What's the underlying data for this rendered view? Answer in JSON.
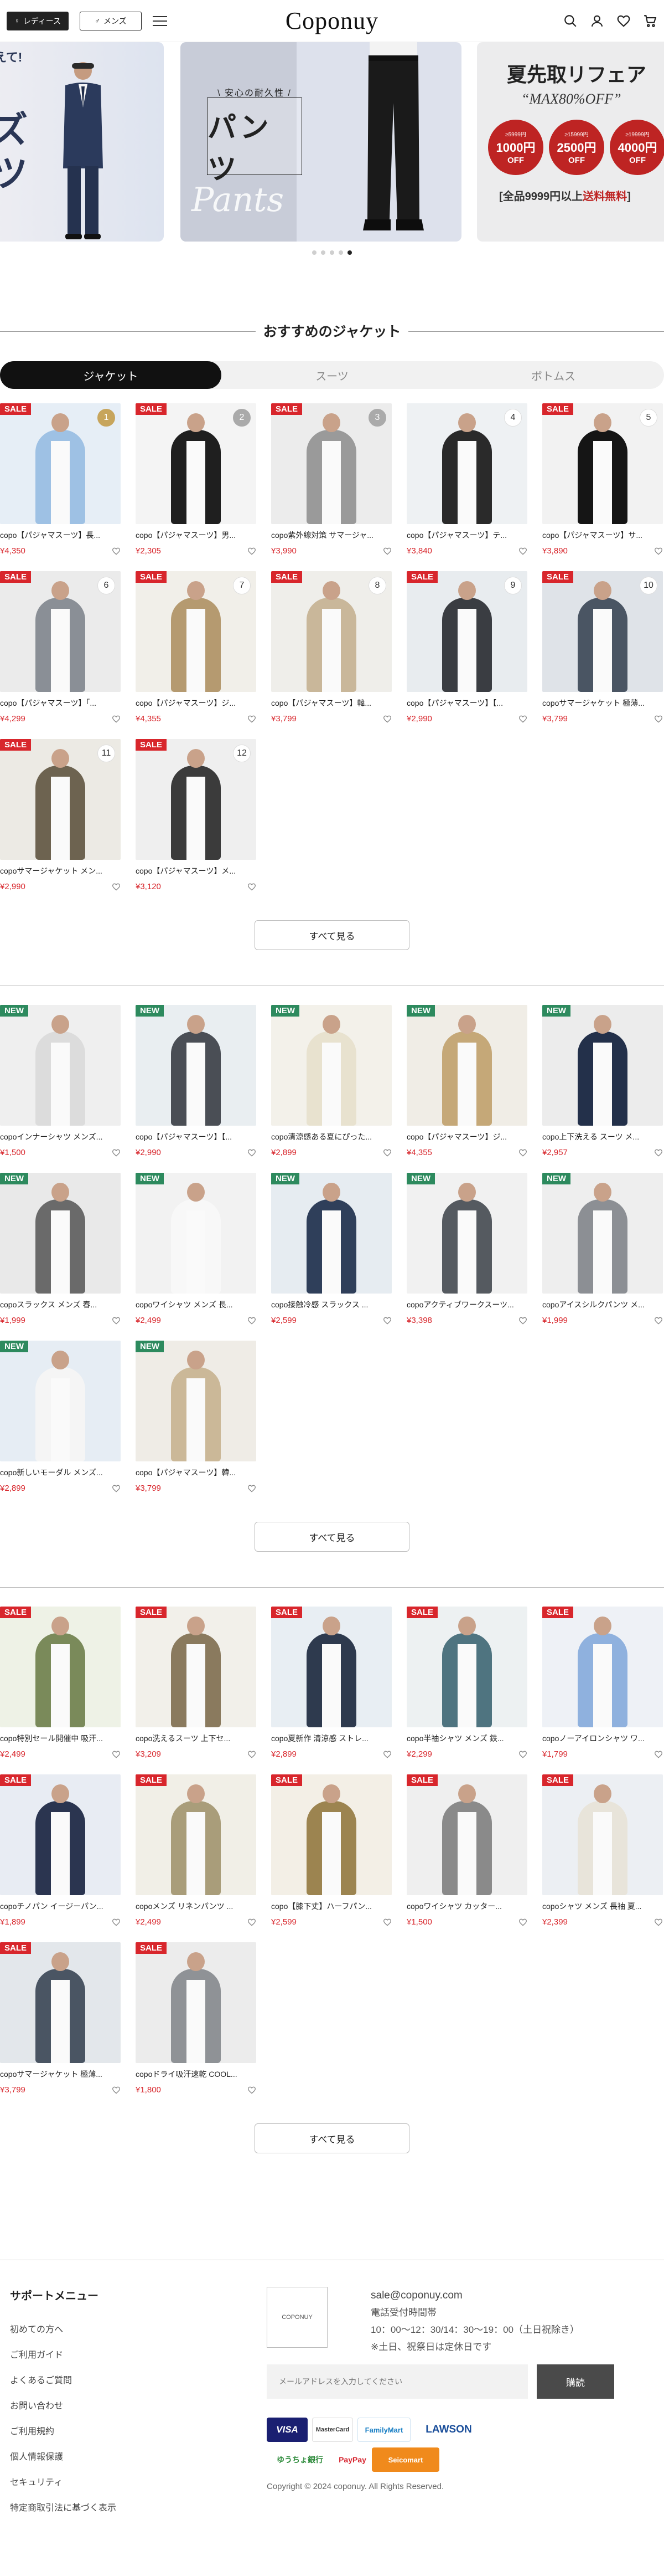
{
  "header": {
    "ladies_label": "レディース",
    "mens_label": "メンズ",
    "logo": "Coponuy"
  },
  "banner": {
    "slide1": {
      "corner": "えて!",
      "big": "ズ\nツ"
    },
    "slide2": {
      "small": "\\ 安心の耐久性 /",
      "large": "パンツ",
      "script": "Pants"
    },
    "slide3": {
      "title": "夏先取リフェア",
      "subtitle": "“MAX80%OFF”",
      "offers": [
        {
          "cond": "≥5999円",
          "amount": "1000円",
          "off": "OFF"
        },
        {
          "cond": "≥15999円",
          "amount": "2500円",
          "off": "OFF"
        },
        {
          "cond": "≥19999円",
          "amount": "4000円",
          "off": "OFF"
        }
      ],
      "note_prefix": "[全品9999円以上",
      "note_red": "送料無料",
      "note_suffix": "]"
    },
    "dot_count": 5,
    "active_dot": 4
  },
  "section1": {
    "title": "おすすめのジャケット",
    "tabs": [
      "ジャケット",
      "スーツ",
      "ボトムス"
    ],
    "active_tab": 0,
    "more_label": "すべて見る",
    "products": [
      {
        "name": "copo【パジャマスーツ】長...",
        "price": "¥4,350",
        "badge": "SALE",
        "rank": "1",
        "bg": "#e6eef6",
        "body": "#9ec1e4"
      },
      {
        "name": "copo【パジャマスーツ】男...",
        "price": "¥2,305",
        "badge": "SALE",
        "rank": "2",
        "bg": "#f4f4f4",
        "body": "#1f1f1f"
      },
      {
        "name": "copo紫外線対策 サマージャ...",
        "price": "¥3,990",
        "badge": "SALE",
        "rank": "3",
        "bg": "#ececec",
        "body": "#9a9a9a"
      },
      {
        "name": "copo【パジャマスーツ】テ...",
        "price": "¥3,840",
        "badge": "",
        "rank": "4",
        "bg": "#eef1f3",
        "body": "#2a2a2a"
      },
      {
        "name": "copo【パジャマスーツ】サ...",
        "price": "¥3,890",
        "badge": "SALE",
        "rank": "5",
        "bg": "#f2f2f2",
        "body": "#151515"
      },
      {
        "name": "copo【パジャマスーツ】「...",
        "price": "¥4,299",
        "badge": "SALE",
        "rank": "6",
        "bg": "#ebebeb",
        "body": "#8a8f96"
      },
      {
        "name": "copo【パジャマスーツ】ジ...",
        "price": "¥4,355",
        "badge": "SALE",
        "rank": "7",
        "bg": "#f1efe9",
        "body": "#b59a70"
      },
      {
        "name": "copo【パジャマスーツ】韓...",
        "price": "¥3,799",
        "badge": "SALE",
        "rank": "8",
        "bg": "#efeeea",
        "body": "#c9b79a"
      },
      {
        "name": "copo【パジャマスーツ】【...",
        "price": "¥2,990",
        "badge": "SALE",
        "rank": "9",
        "bg": "#e8ecef",
        "body": "#3a3d42"
      },
      {
        "name": "copoサマージャケット 極薄...",
        "price": "¥3,799",
        "badge": "SALE",
        "rank": "10",
        "bg": "#dfe3e8",
        "body": "#4a5563"
      },
      {
        "name": "copoサマージャケット メン...",
        "price": "¥2,990",
        "badge": "SALE",
        "rank": "11",
        "bg": "#eceae4",
        "body": "#6d6350"
      },
      {
        "name": "copo【パジャマスーツ】メ...",
        "price": "¥3,120",
        "badge": "SALE",
        "rank": "12",
        "bg": "#efefef",
        "body": "#3b3b3b"
      }
    ]
  },
  "section2": {
    "more_label": "すべて見る",
    "products": [
      {
        "name": "copoインナーシャツ メンズ...",
        "price": "¥1,500",
        "badge": "NEW",
        "bg": "#efefef",
        "body": "#dcdcdc"
      },
      {
        "name": "copo【パジャマスーツ】【...",
        "price": "¥2,990",
        "badge": "NEW",
        "bg": "#e9eef1",
        "body": "#4a4e55"
      },
      {
        "name": "copo清涼感ある夏にぴった...",
        "price": "¥2,899",
        "badge": "NEW",
        "bg": "#f3f1ea",
        "body": "#e8e2cf"
      },
      {
        "name": "copo【パジャマスーツ】ジ...",
        "price": "¥4,355",
        "badge": "NEW",
        "bg": "#f0ede6",
        "body": "#c5a878"
      },
      {
        "name": "copo上下洗える スーツ メ...",
        "price": "¥2,957",
        "badge": "NEW",
        "bg": "#ececec",
        "body": "#23304a"
      },
      {
        "name": "copoスラックス メンズ 春...",
        "price": "¥1,999",
        "badge": "NEW",
        "bg": "#e9e9e9",
        "body": "#6a6a6a"
      },
      {
        "name": "copoワイシャツ メンズ 長...",
        "price": "¥2,499",
        "badge": "NEW",
        "bg": "#f2f2f2",
        "body": "#f8f8f8"
      },
      {
        "name": "copo接触冷感 スラックス ...",
        "price": "¥2,599",
        "badge": "NEW",
        "bg": "#e6ecf1",
        "body": "#2f3f5a"
      },
      {
        "name": "copoアクティブワークスーツ...",
        "price": "¥3,398",
        "badge": "NEW",
        "bg": "#f1f1f1",
        "body": "#555a60"
      },
      {
        "name": "copoアイスシルクパンツ メ...",
        "price": "¥1,999",
        "badge": "NEW",
        "bg": "#eeeeee",
        "body": "#8c8f94"
      },
      {
        "name": "copo新しいモーダル メンズ...",
        "price": "¥2,899",
        "badge": "NEW",
        "bg": "#e6edf4",
        "body": "#f5f5f5"
      },
      {
        "name": "copo【パジャマスーツ】韓...",
        "price": "¥3,799",
        "badge": "NEW",
        "bg": "#efece6",
        "body": "#cbb898"
      }
    ]
  },
  "section3": {
    "more_label": "すべて見る",
    "products": [
      {
        "name": "copo特別セール開催中 吸汗...",
        "price": "¥2,499",
        "badge": "SALE",
        "bg": "#eef2e6",
        "body": "#7a8a5a"
      },
      {
        "name": "copo洗えるスーツ 上下セ...",
        "price": "¥3,209",
        "badge": "SALE",
        "bg": "#f2f0ea",
        "body": "#8a7a5e"
      },
      {
        "name": "copo夏新作 清涼感 ストレ...",
        "price": "¥2,899",
        "badge": "SALE",
        "bg": "#e8eef3",
        "body": "#2e3a4e"
      },
      {
        "name": "copo半袖シャツ メンズ 鉄...",
        "price": "¥2,299",
        "badge": "SALE",
        "bg": "#edf1f2",
        "body": "#4f7480"
      },
      {
        "name": "copoノーアイロンシャツ ワ...",
        "price": "¥1,799",
        "badge": "SALE",
        "bg": "#eef1f6",
        "body": "#8fb1de"
      },
      {
        "name": "copoチノパン イージーパン...",
        "price": "¥1,899",
        "badge": "SALE",
        "bg": "#e8ecf3",
        "body": "#2b3550"
      },
      {
        "name": "copoメンズ リネンパンツ ...",
        "price": "¥2,499",
        "badge": "SALE",
        "bg": "#f1efe7",
        "body": "#a99d7a"
      },
      {
        "name": "copo【膝下丈】ハーフパン...",
        "price": "¥2,599",
        "badge": "SALE",
        "bg": "#f3efe6",
        "body": "#9c8450"
      },
      {
        "name": "copoワイシャツ カッター...",
        "price": "¥1,500",
        "badge": "SALE",
        "bg": "#efefef",
        "body": "#8a8a8a"
      },
      {
        "name": "copoシャツ メンズ 長袖 夏...",
        "price": "¥2,399",
        "badge": "SALE",
        "bg": "#eceff3",
        "body": "#e8e4da"
      },
      {
        "name": "copoサマージャケット 極薄...",
        "price": "¥3,799",
        "badge": "SALE",
        "bg": "#e3e7eb",
        "body": "#4a5563"
      },
      {
        "name": "copoドライ吸汗速乾 COOL...",
        "price": "¥1,800",
        "badge": "SALE",
        "bg": "#ececec",
        "body": "#8f9296"
      }
    ]
  },
  "footer": {
    "menu_title": "サポートメニュー",
    "menu": [
      "初めての方へ",
      "ご利用ガイド",
      "よくあるご質問",
      "お問い合わせ",
      "ご利用規約",
      "個人情報保護",
      "セキュリティ",
      "特定商取引法に基づく表示"
    ],
    "logo_box": "COPONUY",
    "email": "sale@coponuy.com",
    "hours_label": "電話受付時間帯",
    "hours": "10：00〜12：30/14：30〜19：00（土日祝除き）",
    "note": "※土日、祝祭日は定休日です",
    "newsletter_placeholder": "メールアドレスを入力してください",
    "subscribe_label": "購読",
    "payments": [
      "VISA",
      "MasterCard",
      "FamilyMart",
      "LAWSON",
      "ゆうちょ銀行",
      "PayPay",
      "Seicomart"
    ],
    "copyright": "Copyright © 2024 coponuy. All Rights Reserved."
  }
}
